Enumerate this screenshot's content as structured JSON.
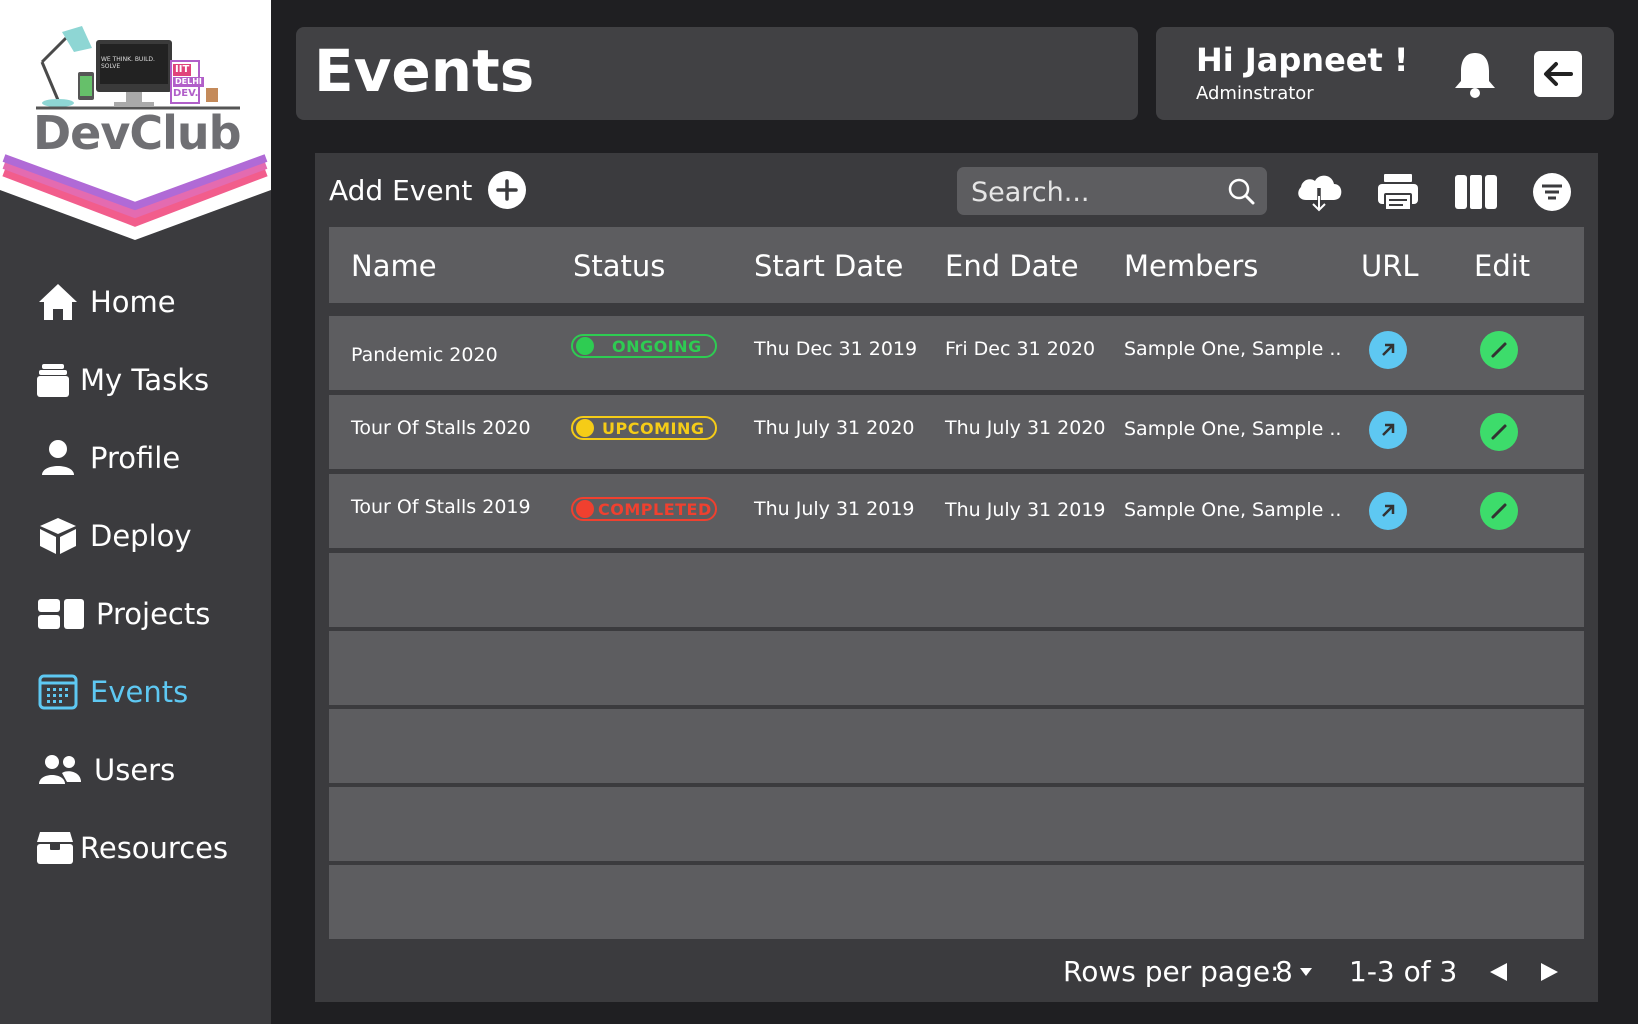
{
  "brand": {
    "name": "DevClub",
    "badge_lines": [
      "IIT",
      "DELHI",
      "DEV."
    ],
    "screen_text": "WE THINK. BUILD. SOLVE"
  },
  "sidebar": {
    "items": [
      {
        "label": "Home",
        "icon": "home-icon"
      },
      {
        "label": "My Tasks",
        "icon": "tasks-icon"
      },
      {
        "label": "Profile",
        "icon": "person-icon"
      },
      {
        "label": "Deploy",
        "icon": "box-icon"
      },
      {
        "label": "Projects",
        "icon": "projects-icon"
      },
      {
        "label": "Events",
        "icon": "calendar-icon",
        "active": true
      },
      {
        "label": "Users",
        "icon": "users-icon"
      },
      {
        "label": "Resources",
        "icon": "resources-icon"
      }
    ]
  },
  "header": {
    "title": "Events",
    "greeting": "Hi Japneet !",
    "role": "Adminstrator"
  },
  "toolbar": {
    "add_label": "Add Event",
    "search_placeholder": "Search..."
  },
  "table": {
    "columns": [
      "Name",
      "Status",
      "Start Date",
      "End Date",
      "Members",
      "URL",
      "Edit"
    ],
    "rows": [
      {
        "name": "Pandemic 2020",
        "status": "ONGOING",
        "start": "Thu Dec 31 2019",
        "end": "Fri Dec 31 2020",
        "members": "Sample One, Sample .."
      },
      {
        "name": "Tour Of Stalls 2020",
        "status": "UPCOMING",
        "start": "Thu July 31 2020",
        "end": "Thu July 31 2020",
        "members": "Sample One, Sample .."
      },
      {
        "name": "Tour Of Stalls 2019",
        "status": "COMPLETED",
        "start": "Thu July 31 2019",
        "end": "Thu July 31 2019",
        "members": "Sample One, Sample .."
      }
    ]
  },
  "pagination": {
    "rows_label": "Rows per page:",
    "rows_value": "8",
    "range": "1-3 of 3"
  },
  "colors": {
    "accent": "#5ec8f2",
    "ongoing": "#2ecc52",
    "upcoming": "#f5cc17",
    "completed": "#f0402f",
    "url_button": "#5ec8f2",
    "edit_button": "#3ddc6b"
  }
}
